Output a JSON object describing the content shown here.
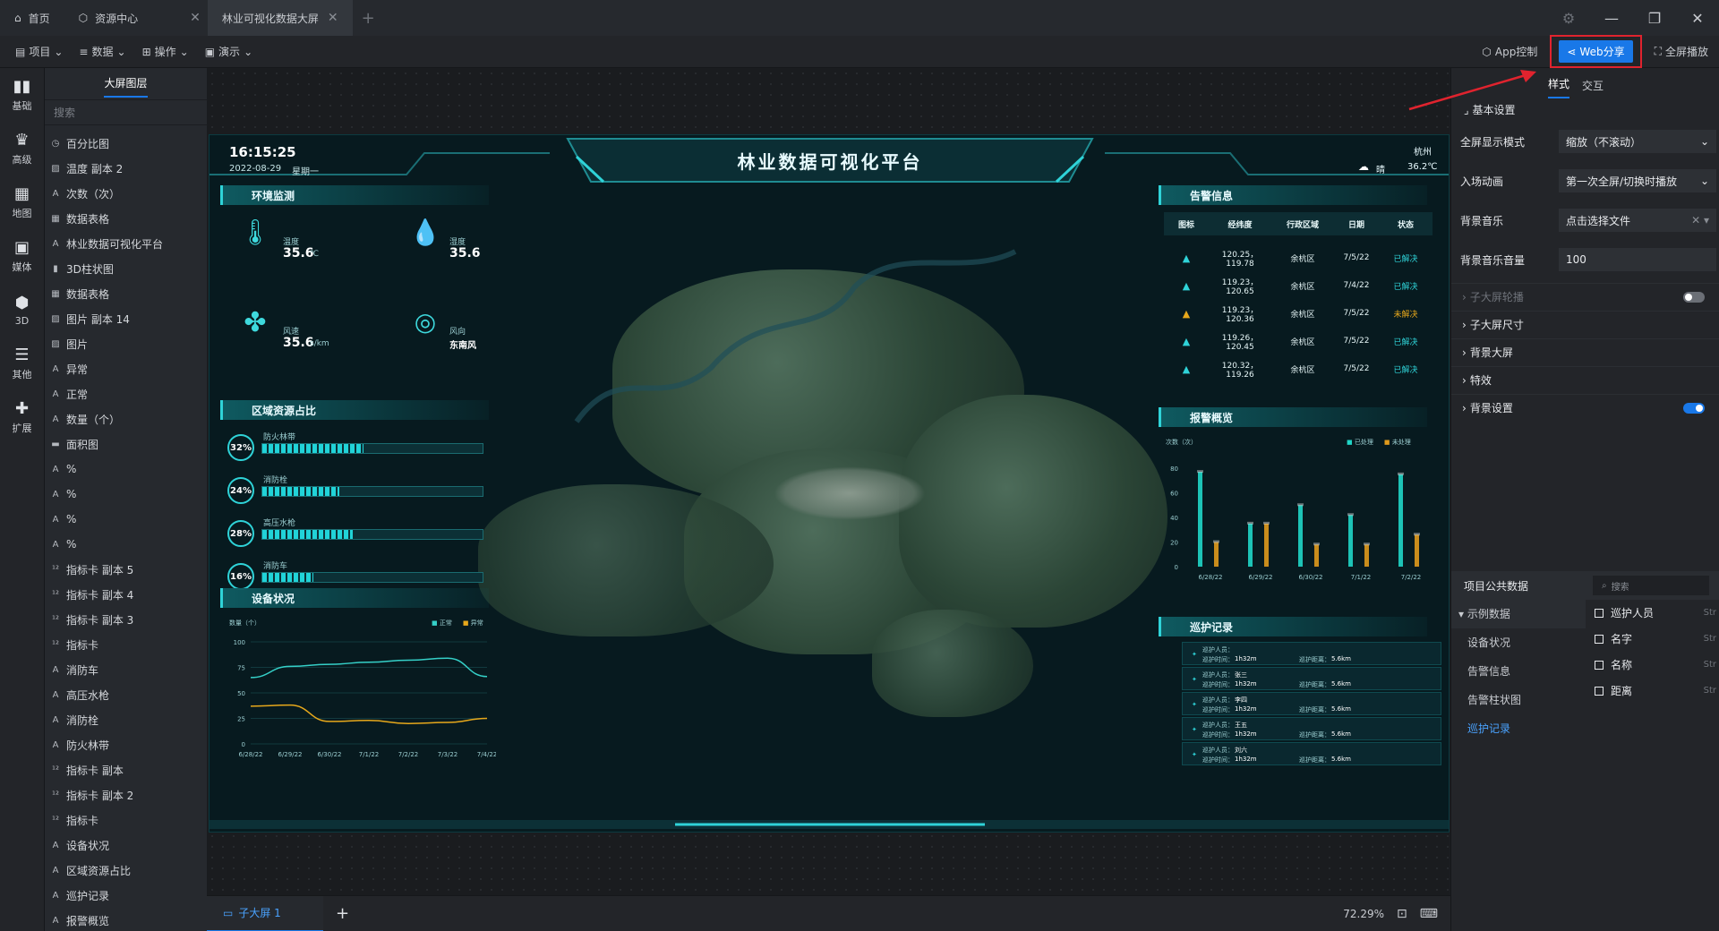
{
  "tabs": [
    {
      "label": "首页",
      "icon": "home-icon"
    },
    {
      "label": "资源中心",
      "icon": "cube-icon"
    },
    {
      "label": "林业可视化数据大屏",
      "active": true
    }
  ],
  "toolbar": {
    "menus": [
      "项目",
      "数据",
      "操作",
      "演示"
    ],
    "app_control": "App控制",
    "web_share": "Web分享",
    "fullscreen": "全屏播放"
  },
  "iconbar": [
    "基础",
    "高级",
    "地图",
    "媒体",
    "3D",
    "其他",
    "扩展"
  ],
  "layers": {
    "title": "大屏图层",
    "search_placeholder": "搜索",
    "items": [
      {
        "icon": "clock-icon",
        "label": "百分比图"
      },
      {
        "icon": "image-icon",
        "label": "温度 副本 2"
      },
      {
        "icon": "text-icon",
        "label": "次数（次）"
      },
      {
        "icon": "table-icon",
        "label": "数据表格"
      },
      {
        "icon": "text-icon",
        "label": "林业数据可视化平台"
      },
      {
        "icon": "bar-icon",
        "label": "3D柱状图"
      },
      {
        "icon": "table-icon",
        "label": "数据表格"
      },
      {
        "icon": "image-icon",
        "label": "图片 副本 14"
      },
      {
        "icon": "image-icon",
        "label": "图片"
      },
      {
        "icon": "text-icon",
        "label": "异常"
      },
      {
        "icon": "text-icon",
        "label": "正常"
      },
      {
        "icon": "text-icon",
        "label": "数量（个）"
      },
      {
        "icon": "area-icon",
        "label": "面积图"
      },
      {
        "icon": "text-icon",
        "label": "%"
      },
      {
        "icon": "text-icon",
        "label": "%"
      },
      {
        "icon": "text-icon",
        "label": "%"
      },
      {
        "icon": "text-icon",
        "label": "%"
      },
      {
        "icon": "number-icon",
        "label": "指标卡 副本 5"
      },
      {
        "icon": "number-icon",
        "label": "指标卡 副本 4"
      },
      {
        "icon": "number-icon",
        "label": "指标卡 副本 3"
      },
      {
        "icon": "number-icon",
        "label": "指标卡"
      },
      {
        "icon": "text-icon",
        "label": "消防车"
      },
      {
        "icon": "text-icon",
        "label": "高压水枪"
      },
      {
        "icon": "text-icon",
        "label": "消防栓"
      },
      {
        "icon": "text-icon",
        "label": "防火林带"
      },
      {
        "icon": "number-icon",
        "label": "指标卡 副本"
      },
      {
        "icon": "number-icon",
        "label": "指标卡 副本 2"
      },
      {
        "icon": "number-icon",
        "label": "指标卡"
      },
      {
        "icon": "text-icon",
        "label": "设备状况"
      },
      {
        "icon": "text-icon",
        "label": "区域资源占比"
      },
      {
        "icon": "text-icon",
        "label": "巡护记录"
      },
      {
        "icon": "text-icon",
        "label": "报警概览"
      }
    ]
  },
  "bottom": {
    "sub_screen": "子大屏 1",
    "zoom": "72.29%"
  },
  "rightpanel": {
    "tabs": [
      "样式",
      "交互"
    ],
    "basic": "基本设置",
    "rows": [
      {
        "label": "全屏显示模式",
        "value": "缩放（不滚动）"
      },
      {
        "label": "入场动画",
        "value": "第一次全屏/切换时播放"
      },
      {
        "label": "背景音乐",
        "value": "点击选择文件"
      },
      {
        "label": "背景音乐音量",
        "value": "100"
      }
    ],
    "collapsibles": [
      {
        "label": "子大屏轮播",
        "dim": true,
        "toggle": "off"
      },
      {
        "label": "子大屏尺寸"
      },
      {
        "label": "背景大屏"
      },
      {
        "label": "特效"
      },
      {
        "label": "背景设置",
        "toggle": "on"
      }
    ],
    "public_data": "项目公共数据",
    "search_placeholder": "搜索",
    "tree": {
      "group": "示例数据",
      "items": [
        "设备状况",
        "告警信息",
        "告警柱状图",
        "巡护记录"
      ],
      "selected": "巡护记录"
    },
    "fields": [
      {
        "name": "巡护人员",
        "type": "Str"
      },
      {
        "name": "名字",
        "type": "Str"
      },
      {
        "name": "名称",
        "type": "Str"
      },
      {
        "name": "距离",
        "type": "Str"
      }
    ]
  },
  "dashboard": {
    "time": "16:15:25",
    "date": "2022-08-29",
    "weekday": "星期一",
    "title": "林业数据可视化平台",
    "city": "杭州",
    "weather": "晴",
    "temp": "36.2℃",
    "env": {
      "title": "环境监测",
      "items": [
        {
          "label": "温度",
          "value": "35.6",
          "unit": "℃"
        },
        {
          "label": "湿度",
          "value": "35.6",
          "unit": ""
        },
        {
          "label": "风速",
          "value": "35.6",
          "unit": "s/km"
        },
        {
          "label": "风向",
          "value": "东南风",
          "unit": ""
        }
      ]
    },
    "region": {
      "title": "区域资源占比",
      "items": [
        {
          "label": "防火林带",
          "pct": "32",
          "fill": 0.32
        },
        {
          "label": "消防栓",
          "pct": "24",
          "fill": 0.24
        },
        {
          "label": "高压水枪",
          "pct": "28",
          "fill": 0.28
        },
        {
          "label": "消防车",
          "pct": "16",
          "fill": 0.16
        }
      ]
    },
    "device": {
      "title": "设备状况",
      "ylabel": "数量（个）",
      "legend": [
        "正常",
        "异常"
      ],
      "yticks": [
        "100",
        "75",
        "50",
        "25",
        "0"
      ],
      "xticks": [
        "6/28/22",
        "6/29/22",
        "6/30/22",
        "7/1/22",
        "7/2/22",
        "7/3/22",
        "7/4/22"
      ]
    },
    "alerts": {
      "title": "告警信息",
      "headers": [
        "图标",
        "经纬度",
        "行政区域",
        "日期",
        "状态"
      ],
      "rows": [
        {
          "coord": "120.25，119.78",
          "area": "余杭区",
          "date": "7/5/22",
          "status": "已解决",
          "level": "normal"
        },
        {
          "coord": "119.23，120.65",
          "area": "余杭区",
          "date": "7/4/22",
          "status": "已解决",
          "level": "normal"
        },
        {
          "coord": "119.23，120.36",
          "area": "余杭区",
          "date": "7/5/22",
          "status": "未解决",
          "level": "warn"
        },
        {
          "coord": "119.26，120.45",
          "area": "余杭区",
          "date": "7/5/22",
          "status": "已解决",
          "level": "normal"
        },
        {
          "coord": "120.32，119.26",
          "area": "余杭区",
          "date": "7/5/22",
          "status": "已解决",
          "level": "normal"
        }
      ]
    },
    "alarm_overview": {
      "title": "报警概览",
      "ylabel": "次数（次）",
      "legend": [
        "已处理",
        "未处理"
      ]
    },
    "patrol": {
      "title": "巡护记录",
      "person_label": "巡护人员：",
      "time_label": "巡护时间：",
      "dist_label": "巡护距离：",
      "rows": [
        {
          "name": "",
          "time": "1h32m",
          "dist": "5.6km"
        },
        {
          "name": "张三",
          "time": "1h32m",
          "dist": "5.6km"
        },
        {
          "name": "李四",
          "time": "1h32m",
          "dist": "5.6km"
        },
        {
          "name": "王五",
          "time": "1h32m",
          "dist": "5.6km"
        },
        {
          "name": "刘六",
          "time": "1h32m",
          "dist": "5.6km"
        }
      ]
    }
  },
  "chart_data": [
    {
      "type": "line",
      "x": [
        "6/28/22",
        "6/29/22",
        "6/30/22",
        "7/1/22",
        "7/2/22",
        "7/3/22",
        "7/4/22"
      ],
      "ylim": [
        0,
        100
      ],
      "ylabel": "数量（个）",
      "series": [
        {
          "name": "正常",
          "values": [
            65,
            76,
            78,
            80,
            82,
            84,
            66
          ]
        },
        {
          "name": "异常",
          "values": [
            37,
            38,
            22,
            23,
            20,
            21,
            25
          ]
        }
      ],
      "colors": [
        "#35d0c8",
        "#e7a81b"
      ]
    },
    {
      "type": "bar",
      "categories": [
        "6/28/22",
        "6/29/22",
        "6/30/22",
        "7/1/22",
        "7/2/22"
      ],
      "ylim": [
        0,
        80
      ],
      "yticks": [
        "80",
        "60",
        "40",
        "20",
        "0"
      ],
      "ylabel": "次数（次）",
      "series": [
        {
          "name": "已处理",
          "values": [
            77,
            35,
            50,
            42,
            75
          ]
        },
        {
          "name": "未处理",
          "values": [
            20,
            35,
            18,
            18,
            26
          ]
        }
      ],
      "colors": [
        "#20d6c7",
        "#e09a1c"
      ]
    }
  ]
}
